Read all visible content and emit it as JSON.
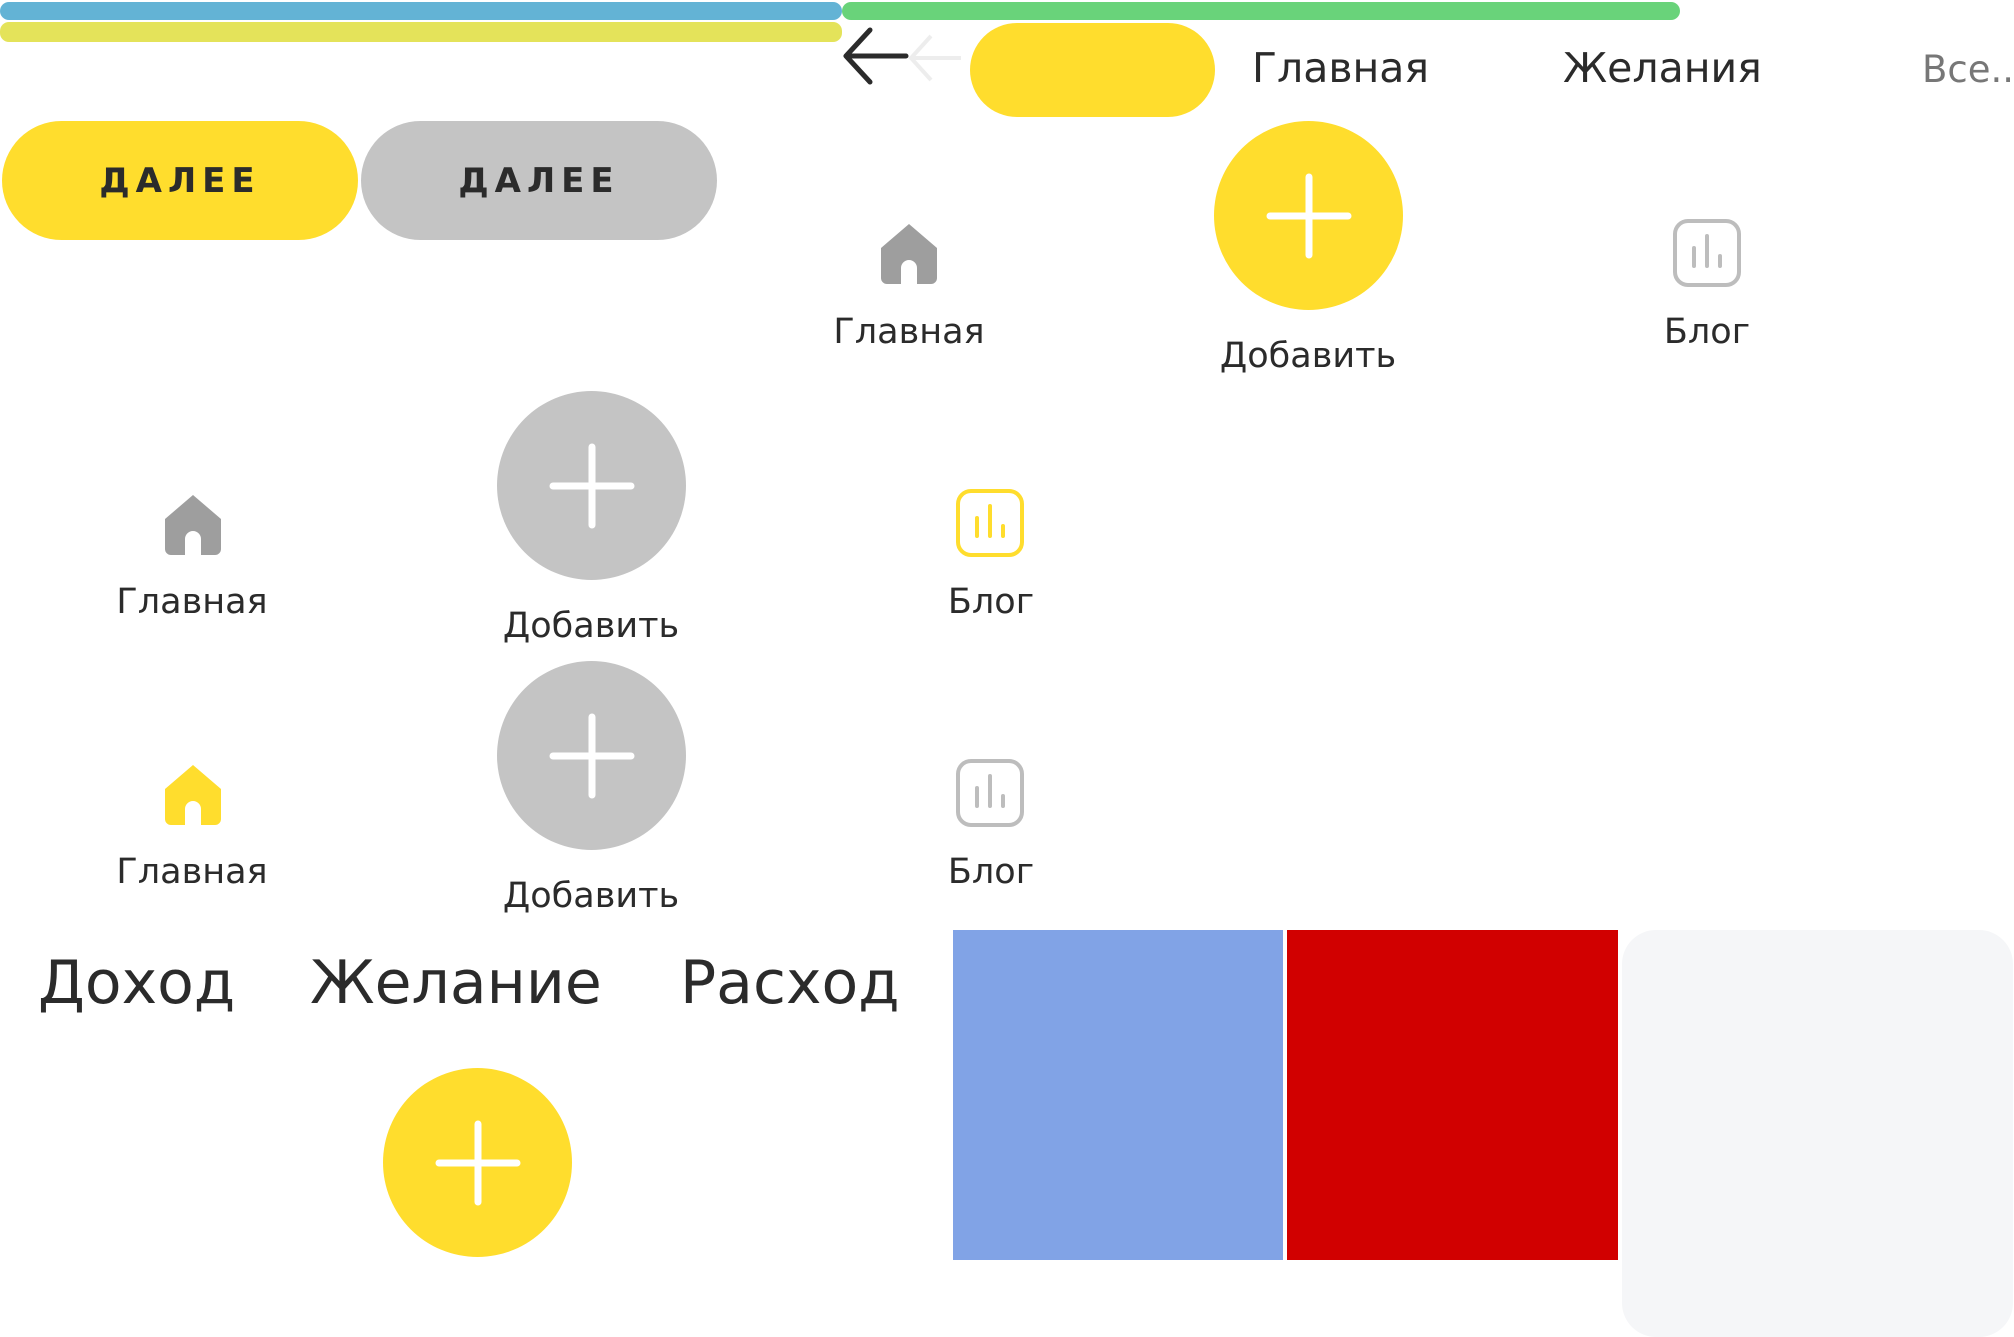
{
  "colors": {
    "yellow": "#FFDD2D",
    "gray": "#C4C4C4",
    "blue_bar": "#63B3D5",
    "green_bar": "#69D37A",
    "lime_bar": "#E4E35A",
    "swatch_blue": "#81A3E6",
    "swatch_red": "#D10000",
    "swatch_light": "#F5F6F8",
    "text": "#2B2B2B",
    "muted": "#777777"
  },
  "buttons": {
    "next_active": "ДАЛЕЕ",
    "next_disabled": "ДАЛЕЕ"
  },
  "top_nav": {
    "back_icon": "arrow-left-icon",
    "tab_home": "Главная",
    "tab_wishes": "Желания",
    "tab_all": "Все..."
  },
  "tabbar_1": {
    "home": "Главная",
    "add": "Добавить",
    "blog": "Блог"
  },
  "tabbar_2": {
    "home": "Главная",
    "add": "Добавить",
    "blog": "Блог"
  },
  "tabbar_3": {
    "home": "Главная",
    "add": "Добавить",
    "blog": "Блог"
  },
  "type_tabs": {
    "income": "Доход",
    "wish": "Желание",
    "expense": "Расход"
  },
  "icons": [
    "arrow-left-icon",
    "home-icon",
    "plus-icon",
    "chart-icon"
  ]
}
